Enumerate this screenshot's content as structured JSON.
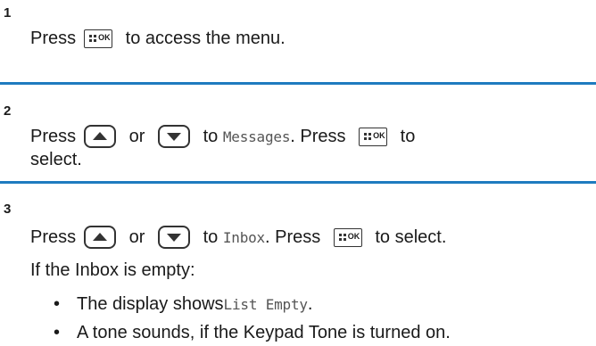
{
  "step1": {
    "number": "1",
    "press": "Press",
    "after": " to access the menu."
  },
  "step2": {
    "number": "2",
    "press": "Press",
    "or": " or ",
    "to": " to ",
    "item": "Messages",
    "press2": ". Press ",
    "select": " to",
    "select2": "select."
  },
  "step3": {
    "number": "3",
    "press": "Press",
    "or": " or ",
    "to": " to ",
    "item": "Inbox",
    "press2": ". Press ",
    "select": " to select.",
    "condition": "If the Inbox is empty:",
    "bullets": [
      {
        "prefix": "The display shows ",
        "mono": "List Empty",
        "suffix": "."
      },
      {
        "prefix": "A tone sounds, if the Keypad Tone is turned on.",
        "mono": "",
        "suffix": ""
      }
    ]
  },
  "keys": {
    "ok_label": "OK",
    "up": "up-arrow-key",
    "down": "down-arrow-key"
  },
  "colors": {
    "separator": "#1e7bbf"
  }
}
